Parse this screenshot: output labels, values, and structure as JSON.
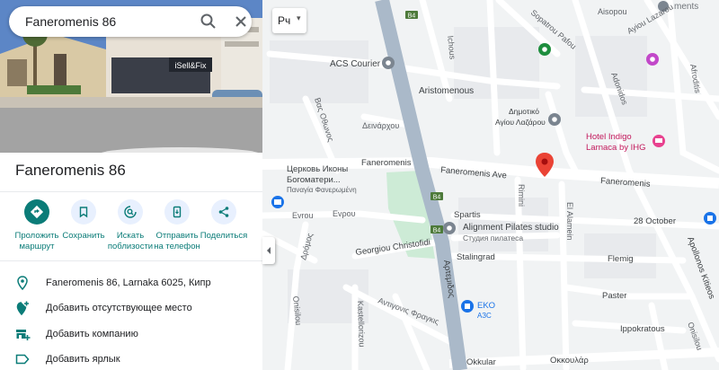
{
  "search": {
    "query": "Faneromenis 86"
  },
  "place": {
    "title": "Faneromenis 86"
  },
  "actions": [
    {
      "label": "Проложить\nмаршрут"
    },
    {
      "label": "Сохранить"
    },
    {
      "label": "Искать\nпоблизости"
    },
    {
      "label": "Отправить\nна телефон"
    },
    {
      "label": "Поделиться"
    }
  ],
  "action_labels": {
    "route_1": "Проложить",
    "route_2": "маршрут",
    "save": "Сохранить",
    "nearby_1": "Искать",
    "nearby_2": "поблизости",
    "phone_1": "Отправить",
    "phone_2": "на телефон",
    "share": "Поделиться"
  },
  "info": {
    "address": "Faneromenis 86, Larnaka 6025, Кипр",
    "add_place": "Добавить отсутствующее место",
    "add_business": "Добавить компанию",
    "add_label": "Добавить ярлык"
  },
  "photo": {
    "sign": "iSell&Fix"
  },
  "map": {
    "layer_button": "Рч",
    "labels": {
      "ichous": "Ichous",
      "sopatrou": "Sopatrou Pafou",
      "aisopou": "Aisopou",
      "lazarou": "Ayiou Lazarou",
      "adonidos": "Adonidos",
      "afroditis": "Afroditis",
      "ments": "ments",
      "acs": "ACS Courier",
      "aristomenous": "Aristomenous",
      "dimotiko1": "Δημοτικό",
      "dimotiko2": "Αγίου Λαζάρου",
      "deinarchou": "Δεινάρχου",
      "vas_othonos": "Βας Οθωνος",
      "hotel1": "Hotel Indigo",
      "hotel2": "Larnaca by IHG",
      "faneromenis_w": "Faneromenis",
      "faneromenis_ave": "Faneromenis Ave",
      "faneromenis_e": "Faneromenis",
      "church1": "Церковь Иконы",
      "church2": "Богоматери...",
      "church3": "Παναγία Φανερωμένη",
      "rimini": "Rimini",
      "el_alamein": "El Alamein",
      "spartis": "Spartis",
      "alignment1": "Alignment Pilates studio",
      "alignment2": "Студия пилатеса",
      "evrou_1": "Evrou",
      "evrou_2": "Εvρου",
      "october": "28 October",
      "dromos": "Δρόμος",
      "georgiou": "Georgiou Christofidi",
      "stalingrad": "Stalingrad",
      "flemig": "Flemig",
      "artemidos": "Αρτεμιδος",
      "apollonos": "Apollonos Kitieos",
      "paster": "Paster",
      "antigonis": "Αντιγονις Φραγκις",
      "kastellorizou": "Kastellorizou",
      "onisilou": "Onisilou",
      "eko1": "EKO",
      "eko2": "АЗС",
      "ippokratous": "Ippokratous",
      "okkular": "Okkular",
      "okkoular": "Οκκουλάρ",
      "onisilou2": "Onisilou",
      "b4": "B4"
    }
  },
  "colors": {
    "accent": "#0b7c78",
    "pin": "#ea4335",
    "highway": "#aab9c9",
    "park": "#cdebd6",
    "hotel_pin": "#e8418f",
    "poi_gray": "#7b8590",
    "pharmacy": "#c248c9"
  }
}
